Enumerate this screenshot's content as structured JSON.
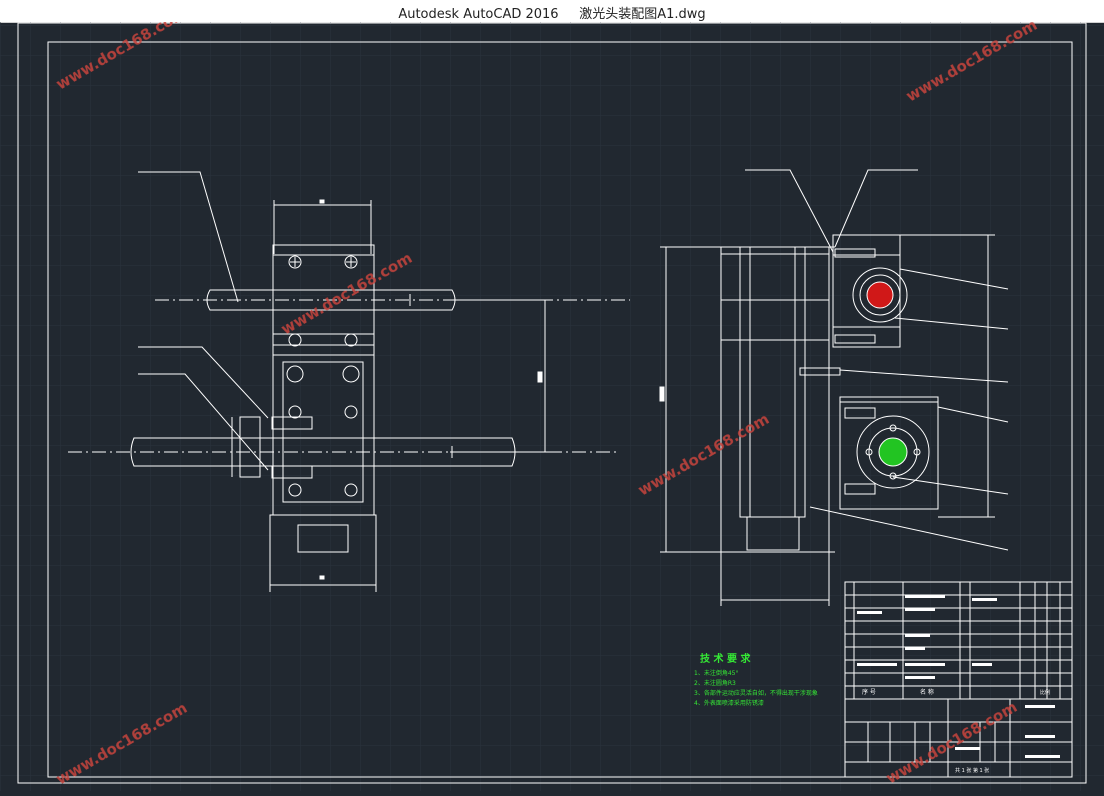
{
  "window": {
    "title": "Autodesk AutoCAD 2016     激光头装配图A1.dwg"
  },
  "drawing": {
    "tech_requirements": {
      "heading": "技 术 要 求",
      "items": [
        "1、未注倒角45°",
        "2、未注圆角R3",
        "3、各部件运动应灵活自如，不得出现干涉现象",
        "4、外表面喷漆采用防锈漆"
      ]
    },
    "title_block": {
      "header_seq": "序 号",
      "header_name": "名 称",
      "scale_label": "比例",
      "bottom_note": "共 1 张   第 1 张"
    }
  },
  "watermark": {
    "text": "www.doc168.com"
  },
  "colors": {
    "background": "#212830",
    "line": "#ffffff",
    "grid": "#2c3440",
    "watermark": "#c9453e",
    "tech_text": "#35e835",
    "red_fill": "#d01818",
    "green_fill": "#22c422"
  }
}
